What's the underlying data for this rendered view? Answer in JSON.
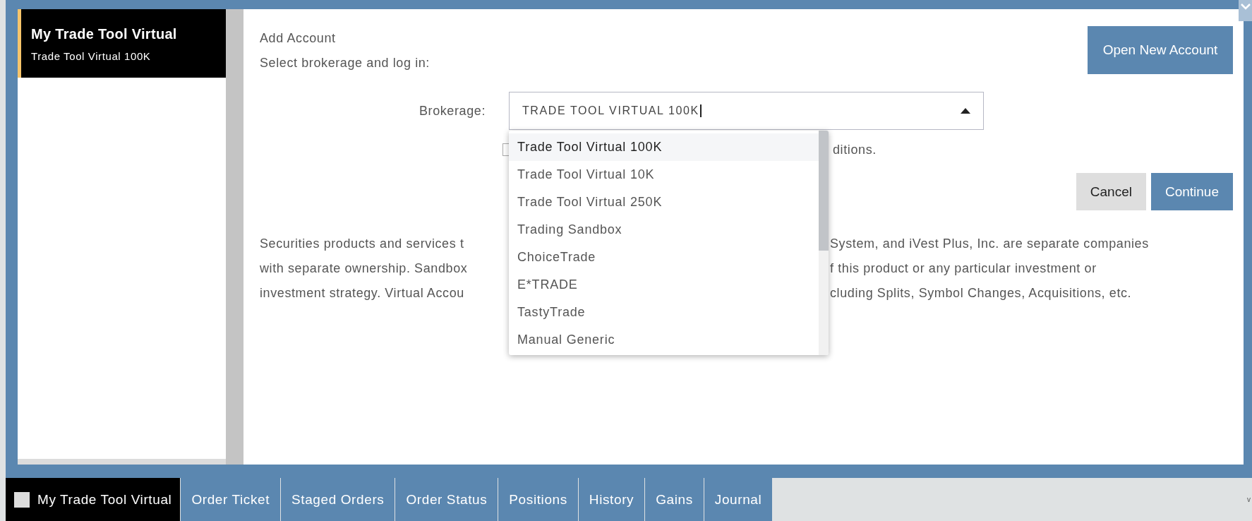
{
  "accounts": [
    {
      "name": "My Trade Tool Virtual",
      "subtitle": "Trade Tool Virtual 100K",
      "selected": true
    }
  ],
  "dialog": {
    "title": "Add Account",
    "instruction": "Select brokerage and log in:",
    "open_button": "Open New Account",
    "brokerage": {
      "label": "Brokerage:",
      "value": "TRADE TOOL VIRTUAL 100K",
      "expanded": true,
      "options": [
        {
          "label": "Trade Tool Virtual 100K",
          "selected": true
        },
        {
          "label": "Trade Tool Virtual 10K",
          "selected": false
        },
        {
          "label": "Trade Tool Virtual 250K",
          "selected": false
        },
        {
          "label": "Trading Sandbox",
          "selected": false
        },
        {
          "label": "ChoiceTrade",
          "selected": false
        },
        {
          "label": "E*TRADE",
          "selected": false
        },
        {
          "label": "TastyTrade",
          "selected": false
        },
        {
          "label": "Manual Generic",
          "selected": false
        }
      ]
    },
    "terms": {
      "checked": false,
      "text_visible": "ditions."
    },
    "cancel_button": "Cancel",
    "continue_button": "Continue",
    "disclaimer_lines": [
      {
        "left": "Securities products and services t",
        "right": "System, and iVest Plus, Inc. are separate companies"
      },
      {
        "left": "with separate ownership. Sandbox",
        "right": "f this product or any particular investment or"
      },
      {
        "left": "investment strategy. Virtual Accou",
        "right": "cluding Splits, Symbol Changes, Acquisitions, etc."
      }
    ]
  },
  "bottom_tabs": [
    {
      "label": "My Trade Tool Virtual",
      "selected": true
    },
    {
      "label": "Order Ticket",
      "selected": false
    },
    {
      "label": "Staged Orders",
      "selected": false
    },
    {
      "label": "Order Status",
      "selected": false
    },
    {
      "label": "Positions",
      "selected": false
    },
    {
      "label": "History",
      "selected": false
    },
    {
      "label": "Gains",
      "selected": false
    },
    {
      "label": "Journal",
      "selected": false
    }
  ],
  "bottom_edge_text": "v"
}
